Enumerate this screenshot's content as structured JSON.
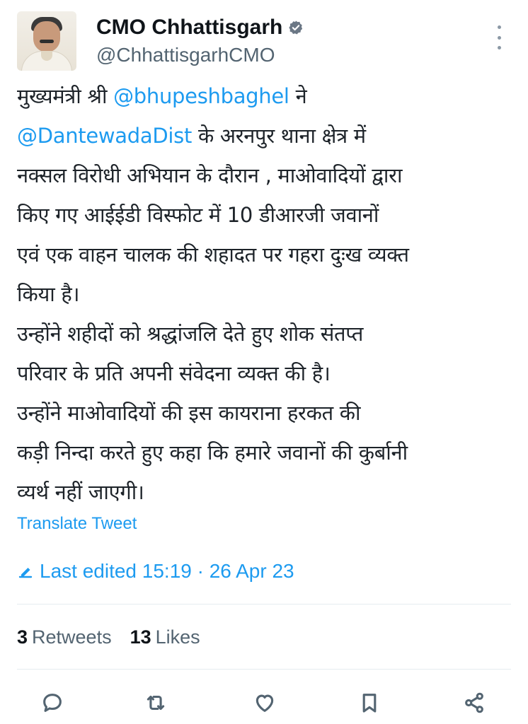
{
  "author": {
    "display_name": "CMO Chhattisgarh",
    "handle": "@ChhattisgarhCMO",
    "verified": true
  },
  "tweet": {
    "lines": [
      [
        {
          "t": "मुख्यमंत्री श्री "
        },
        {
          "t": "@bhupeshbaghel",
          "m": true
        },
        {
          "t": " ने"
        }
      ],
      [
        {
          "t": "@DantewadaDist",
          "m": true
        },
        {
          "t": " के अरनपुर थाना क्षेत्र में"
        }
      ],
      [
        {
          "t": "नक्सल विरोधी अभियान के दौरान , माओवादियों द्वारा"
        }
      ],
      [
        {
          "t": "किए गए आईईडी विस्फोट में 10 डीआरजी जवानों"
        }
      ],
      [
        {
          "t": "एवं एक वाहन चालक की शहादत पर गहरा दुःख व्यक्त"
        }
      ],
      [
        {
          "t": "किया है।"
        }
      ],
      [
        {
          "t": "उन्होंने शहीदों को श्रद्धांजलि देते हुए शोक संतप्त"
        }
      ],
      [
        {
          "t": "परिवार के प्रति अपनी संवेदना व्यक्त की है।"
        }
      ],
      [
        {
          "t": "उन्होंने माओवादियों की इस कायराना हरकत की"
        }
      ],
      [
        {
          "t": "कड़ी निन्दा करते हुए कहा कि हमारे जवानों की कुर्बानी"
        }
      ],
      [
        {
          "t": "व्यर्थ नहीं जाएगी।"
        }
      ]
    ]
  },
  "translate_label": "Translate Tweet",
  "edited": {
    "icon": "pencil-icon",
    "text": "Last edited 15:19 · 26 Apr 23"
  },
  "stats": {
    "retweets_count": "3",
    "retweets_label": "Retweets",
    "likes_count": "13",
    "likes_label": "Likes"
  },
  "actions": [
    {
      "name": "reply",
      "icon": "reply-icon"
    },
    {
      "name": "retweet",
      "icon": "retweet-icon"
    },
    {
      "name": "like",
      "icon": "heart-icon"
    },
    {
      "name": "bookmark",
      "icon": "bookmark-icon"
    },
    {
      "name": "share",
      "icon": "share-icon"
    }
  ],
  "colors": {
    "accent": "#1d9bf0",
    "text": "#0f1419",
    "muted": "#536471"
  }
}
